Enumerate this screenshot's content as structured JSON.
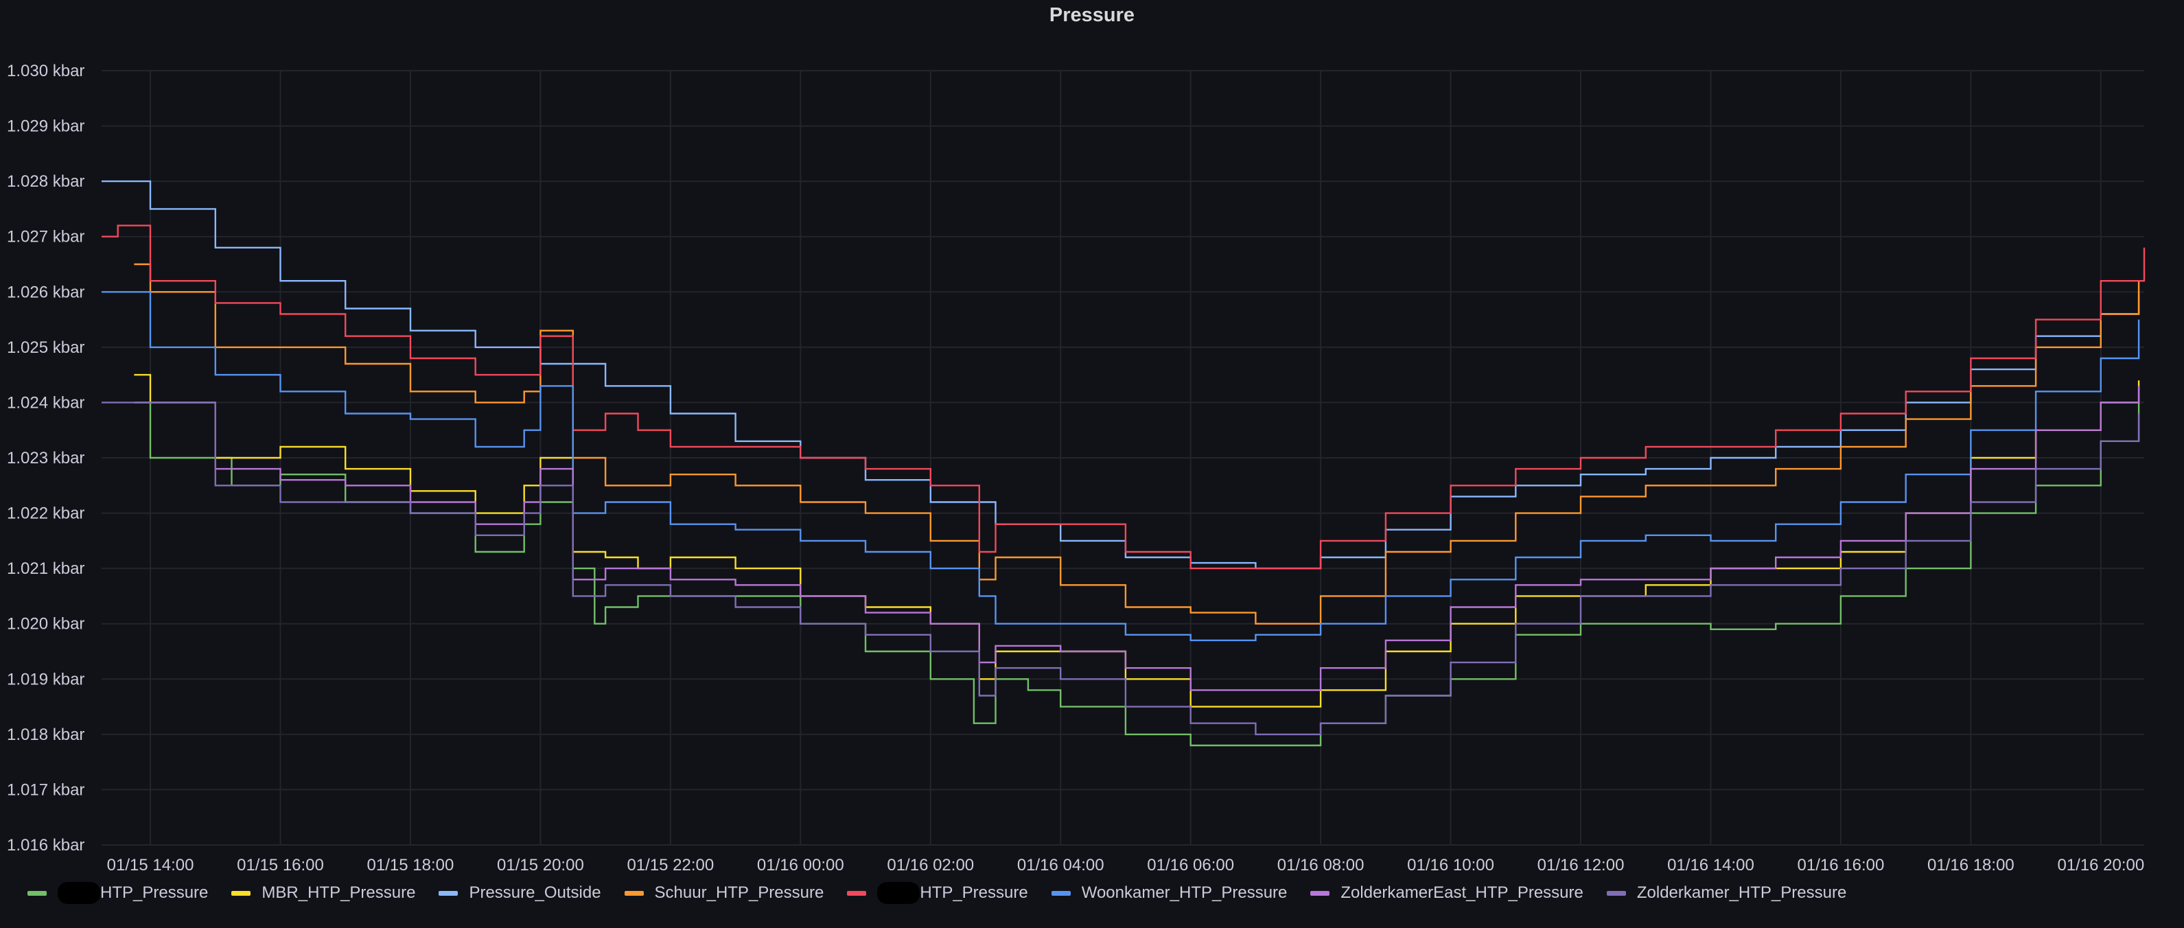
{
  "panel": {
    "title": "Pressure"
  },
  "chart_data": {
    "type": "line",
    "title": "Pressure",
    "xlabel": "",
    "ylabel": "",
    "y_unit": "kbar",
    "ylim": [
      1.016,
      1.03
    ],
    "yticks": [
      "1.016 kbar",
      "1.017 kbar",
      "1.018 kbar",
      "1.019 kbar",
      "1.020 kbar",
      "1.021 kbar",
      "1.022 kbar",
      "1.023 kbar",
      "1.024 kbar",
      "1.025 kbar",
      "1.026 kbar",
      "1.027 kbar",
      "1.028 kbar",
      "1.029 kbar",
      "1.030 kbar"
    ],
    "xlim": [
      "01/15 13:15",
      "01/16 20:40"
    ],
    "xticks": [
      "01/15 14:00",
      "01/15 16:00",
      "01/15 18:00",
      "01/15 20:00",
      "01/15 22:00",
      "01/16 00:00",
      "01/16 02:00",
      "01/16 04:00",
      "01/16 06:00",
      "01/16 08:00",
      "01/16 10:00",
      "01/16 12:00",
      "01/16 14:00",
      "01/16 16:00",
      "01/16 18:00",
      "01/16 20:00"
    ],
    "grid": true,
    "legend_position": "bottom",
    "series": [
      {
        "name": "HTP_Pressure",
        "redacted_prefix": true,
        "color": "#73bf69",
        "x": [
          "01/15 13:45",
          "01/15 14:00",
          "01/15 15:15",
          "01/15 16:00",
          "01/15 17:00",
          "01/15 18:00",
          "01/15 19:00",
          "01/15 19:45",
          "01/15 20:00",
          "01/15 20:30",
          "01/15 20:50",
          "01/15 21:00",
          "01/15 21:30",
          "01/15 22:00",
          "01/15 23:00",
          "01/16 00:00",
          "01/16 01:00",
          "01/16 02:00",
          "01/16 02:40",
          "01/16 03:00",
          "01/16 03:30",
          "01/16 04:00",
          "01/16 05:00",
          "01/16 06:00",
          "01/16 06:40",
          "01/16 08:00",
          "01/16 09:00",
          "01/16 10:00",
          "01/16 11:00",
          "01/16 12:00",
          "01/16 13:00",
          "01/16 14:00",
          "01/16 15:00",
          "01/16 16:00",
          "01/16 17:00",
          "01/16 18:00",
          "01/16 19:00",
          "01/16 20:00",
          "01/16 20:35"
        ],
        "values": [
          1.024,
          1.023,
          1.0225,
          1.0227,
          1.0222,
          1.022,
          1.0213,
          1.0218,
          1.0222,
          1.021,
          1.02,
          1.0203,
          1.0205,
          1.0205,
          1.0205,
          1.02,
          1.0195,
          1.019,
          1.0182,
          1.019,
          1.0188,
          1.0185,
          1.018,
          1.0178,
          1.0178,
          1.0182,
          1.0187,
          1.019,
          1.0198,
          1.02,
          1.02,
          1.0199,
          1.02,
          1.0205,
          1.021,
          1.022,
          1.0225,
          1.0233,
          1.024
        ]
      },
      {
        "name": "MBR_HTP_Pressure",
        "color": "#fade2a",
        "x": [
          "01/15 13:45",
          "01/15 14:00",
          "01/15 15:00",
          "01/15 16:00",
          "01/15 17:00",
          "01/15 18:00",
          "01/15 19:00",
          "01/15 19:45",
          "01/15 20:00",
          "01/15 20:30",
          "01/15 21:00",
          "01/15 21:30",
          "01/15 22:00",
          "01/15 23:00",
          "01/16 00:00",
          "01/16 01:00",
          "01/16 02:00",
          "01/16 02:45",
          "01/16 03:00",
          "01/16 04:00",
          "01/16 05:00",
          "01/16 06:00",
          "01/16 07:00",
          "01/16 08:00",
          "01/16 09:00",
          "01/16 10:00",
          "01/16 11:00",
          "01/16 12:00",
          "01/16 13:00",
          "01/16 14:00",
          "01/16 15:00",
          "01/16 16:00",
          "01/16 17:00",
          "01/16 18:00",
          "01/16 19:00",
          "01/16 20:00",
          "01/16 20:35"
        ],
        "values": [
          1.0245,
          1.024,
          1.023,
          1.0232,
          1.0228,
          1.0224,
          1.022,
          1.0225,
          1.023,
          1.0213,
          1.0212,
          1.021,
          1.0212,
          1.021,
          1.0205,
          1.0203,
          1.02,
          1.019,
          1.0195,
          1.0195,
          1.019,
          1.0185,
          1.0185,
          1.0188,
          1.0195,
          1.02,
          1.0205,
          1.0205,
          1.0207,
          1.021,
          1.021,
          1.0213,
          1.022,
          1.023,
          1.0235,
          1.024,
          1.0244
        ]
      },
      {
        "name": "Pressure_Outside",
        "color": "#8ab8ff",
        "x": [
          "01/15 13:15",
          "01/15 14:00",
          "01/15 15:00",
          "01/15 16:00",
          "01/15 17:00",
          "01/15 18:00",
          "01/15 19:00",
          "01/15 20:00",
          "01/15 21:00",
          "01/15 22:00",
          "01/15 23:00",
          "01/16 00:00",
          "01/16 01:00",
          "01/16 02:00",
          "01/16 03:00",
          "01/16 04:00",
          "01/16 05:00",
          "01/16 06:00",
          "01/16 07:00",
          "01/16 08:00",
          "01/16 09:00",
          "01/16 10:00",
          "01/16 11:00",
          "01/16 12:00",
          "01/16 13:00",
          "01/16 14:00",
          "01/16 15:00",
          "01/16 16:00",
          "01/16 17:00",
          "01/16 18:00",
          "01/16 19:00",
          "01/16 20:00",
          "01/16 20:35"
        ],
        "values": [
          1.028,
          1.0275,
          1.0268,
          1.0262,
          1.0257,
          1.0253,
          1.025,
          1.0247,
          1.0243,
          1.0238,
          1.0233,
          1.023,
          1.0226,
          1.0222,
          1.0218,
          1.0215,
          1.0212,
          1.0211,
          1.021,
          1.0212,
          1.0217,
          1.0223,
          1.0225,
          1.0227,
          1.0228,
          1.023,
          1.0232,
          1.0235,
          1.024,
          1.0246,
          1.0252,
          1.0256,
          1.026
        ]
      },
      {
        "name": "Schuur_HTP_Pressure",
        "color": "#ff9830",
        "x": [
          "01/15 13:45",
          "01/15 14:00",
          "01/15 15:00",
          "01/15 16:00",
          "01/15 17:00",
          "01/15 18:00",
          "01/15 19:00",
          "01/15 19:45",
          "01/15 20:00",
          "01/15 20:30",
          "01/15 21:00",
          "01/15 22:00",
          "01/15 23:00",
          "01/16 00:00",
          "01/16 01:00",
          "01/16 02:00",
          "01/16 02:45",
          "01/16 03:00",
          "01/16 04:00",
          "01/16 05:00",
          "01/16 06:00",
          "01/16 07:00",
          "01/16 08:00",
          "01/16 09:00",
          "01/16 10:00",
          "01/16 11:00",
          "01/16 12:00",
          "01/16 13:00",
          "01/16 14:00",
          "01/16 15:00",
          "01/16 16:00",
          "01/16 17:00",
          "01/16 18:00",
          "01/16 19:00",
          "01/16 20:00",
          "01/16 20:35"
        ],
        "values": [
          1.0265,
          1.026,
          1.025,
          1.025,
          1.0247,
          1.0242,
          1.024,
          1.0242,
          1.0253,
          1.023,
          1.0225,
          1.0227,
          1.0225,
          1.0222,
          1.022,
          1.0215,
          1.0208,
          1.0212,
          1.0207,
          1.0203,
          1.0202,
          1.02,
          1.0205,
          1.0213,
          1.0215,
          1.022,
          1.0223,
          1.0225,
          1.0225,
          1.0228,
          1.0232,
          1.0237,
          1.0243,
          1.025,
          1.0256,
          1.0262
        ]
      },
      {
        "name": "HTP_Pressure",
        "redacted_prefix": true,
        "color": "#f2495c",
        "x": [
          "01/15 13:15",
          "01/15 13:30",
          "01/15 14:00",
          "01/15 15:00",
          "01/15 16:00",
          "01/15 17:00",
          "01/15 18:00",
          "01/15 19:00",
          "01/15 20:00",
          "01/15 20:30",
          "01/15 21:00",
          "01/15 21:30",
          "01/15 22:00",
          "01/15 23:00",
          "01/16 00:00",
          "01/16 01:00",
          "01/16 02:00",
          "01/16 02:45",
          "01/16 03:00",
          "01/16 04:00",
          "01/16 05:00",
          "01/16 06:00",
          "01/16 07:00",
          "01/16 08:00",
          "01/16 09:00",
          "01/16 10:00",
          "01/16 11:00",
          "01/16 12:00",
          "01/16 13:00",
          "01/16 14:00",
          "01/16 15:00",
          "01/16 16:00",
          "01/16 17:00",
          "01/16 18:00",
          "01/16 19:00",
          "01/16 20:00",
          "01/16 20:40"
        ],
        "values": [
          1.027,
          1.0272,
          1.0262,
          1.0258,
          1.0256,
          1.0252,
          1.0248,
          1.0245,
          1.0252,
          1.0235,
          1.0238,
          1.0235,
          1.0232,
          1.0232,
          1.023,
          1.0228,
          1.0225,
          1.0213,
          1.0218,
          1.0218,
          1.0213,
          1.021,
          1.021,
          1.0215,
          1.022,
          1.0225,
          1.0228,
          1.023,
          1.0232,
          1.0232,
          1.0235,
          1.0238,
          1.0242,
          1.0248,
          1.0255,
          1.0262,
          1.0268
        ]
      },
      {
        "name": "Woonkamer_HTP_Pressure",
        "color": "#5794f2",
        "x": [
          "01/15 13:15",
          "01/15 14:00",
          "01/15 15:00",
          "01/15 16:00",
          "01/15 17:00",
          "01/15 18:00",
          "01/15 19:00",
          "01/15 19:45",
          "01/15 20:00",
          "01/15 20:30",
          "01/15 21:00",
          "01/15 22:00",
          "01/15 23:00",
          "01/16 00:00",
          "01/16 01:00",
          "01/16 02:00",
          "01/16 02:45",
          "01/16 03:00",
          "01/16 04:00",
          "01/16 05:00",
          "01/16 06:00",
          "01/16 07:00",
          "01/16 08:00",
          "01/16 09:00",
          "01/16 10:00",
          "01/16 11:00",
          "01/16 12:00",
          "01/16 13:00",
          "01/16 14:00",
          "01/16 15:00",
          "01/16 16:00",
          "01/16 17:00",
          "01/16 18:00",
          "01/16 19:00",
          "01/16 20:00",
          "01/16 20:35"
        ],
        "values": [
          1.026,
          1.025,
          1.0245,
          1.0242,
          1.0238,
          1.0237,
          1.0232,
          1.0235,
          1.0243,
          1.022,
          1.0222,
          1.0218,
          1.0217,
          1.0215,
          1.0213,
          1.021,
          1.0205,
          1.02,
          1.02,
          1.0198,
          1.0197,
          1.0198,
          1.02,
          1.0205,
          1.0208,
          1.0212,
          1.0215,
          1.0216,
          1.0215,
          1.0218,
          1.0222,
          1.0227,
          1.0235,
          1.0242,
          1.0248,
          1.0255
        ]
      },
      {
        "name": "ZolderkamerEast_HTP_Pressure",
        "color": "#b877d9",
        "x": [
          "01/15 13:45",
          "01/15 14:00",
          "01/15 15:00",
          "01/15 16:00",
          "01/15 17:00",
          "01/15 18:00",
          "01/15 19:00",
          "01/15 19:45",
          "01/15 20:00",
          "01/15 20:30",
          "01/15 21:00",
          "01/15 22:00",
          "01/15 23:00",
          "01/16 00:00",
          "01/16 01:00",
          "01/16 02:00",
          "01/16 02:45",
          "01/16 03:00",
          "01/16 04:00",
          "01/16 05:00",
          "01/16 06:00",
          "01/16 07:00",
          "01/16 08:00",
          "01/16 09:00",
          "01/16 10:00",
          "01/16 11:00",
          "01/16 12:00",
          "01/16 13:00",
          "01/16 14:00",
          "01/16 15:00",
          "01/16 16:00",
          "01/16 17:00",
          "01/16 18:00",
          "01/16 19:00",
          "01/16 20:00",
          "01/16 20:35"
        ],
        "values": [
          1.024,
          1.024,
          1.0228,
          1.0226,
          1.0225,
          1.0222,
          1.0218,
          1.0222,
          1.0228,
          1.0208,
          1.021,
          1.0208,
          1.0207,
          1.0205,
          1.0202,
          1.02,
          1.0193,
          1.0196,
          1.0195,
          1.0192,
          1.0188,
          1.0188,
          1.0192,
          1.0197,
          1.0203,
          1.0207,
          1.0208,
          1.0208,
          1.021,
          1.0212,
          1.0215,
          1.022,
          1.0228,
          1.0235,
          1.024,
          1.0243
        ]
      },
      {
        "name": "Zolderkamer_HTP_Pressure",
        "color": "#806eb7",
        "x": [
          "01/15 13:15",
          "01/15 14:00",
          "01/15 15:00",
          "01/15 16:00",
          "01/15 17:00",
          "01/15 18:00",
          "01/15 19:00",
          "01/15 19:45",
          "01/15 20:00",
          "01/15 20:30",
          "01/15 21:00",
          "01/15 22:00",
          "01/15 23:00",
          "01/16 00:00",
          "01/16 01:00",
          "01/16 02:00",
          "01/16 02:45",
          "01/16 03:00",
          "01/16 04:00",
          "01/16 05:00",
          "01/16 06:00",
          "01/16 07:00",
          "01/16 08:00",
          "01/16 09:00",
          "01/16 10:00",
          "01/16 11:00",
          "01/16 12:00",
          "01/16 13:00",
          "01/16 14:00",
          "01/16 15:00",
          "01/16 16:00",
          "01/16 17:00",
          "01/16 18:00",
          "01/16 19:00",
          "01/16 20:00",
          "01/16 20:35"
        ],
        "values": [
          1.024,
          1.024,
          1.0225,
          1.0222,
          1.0222,
          1.022,
          1.0216,
          1.022,
          1.0225,
          1.0205,
          1.0207,
          1.0205,
          1.0203,
          1.02,
          1.0198,
          1.0195,
          1.0187,
          1.0192,
          1.019,
          1.0185,
          1.0182,
          1.018,
          1.0182,
          1.0187,
          1.0193,
          1.02,
          1.0205,
          1.0205,
          1.0207,
          1.0207,
          1.021,
          1.0215,
          1.0222,
          1.0228,
          1.0233,
          1.0238
        ]
      }
    ]
  }
}
